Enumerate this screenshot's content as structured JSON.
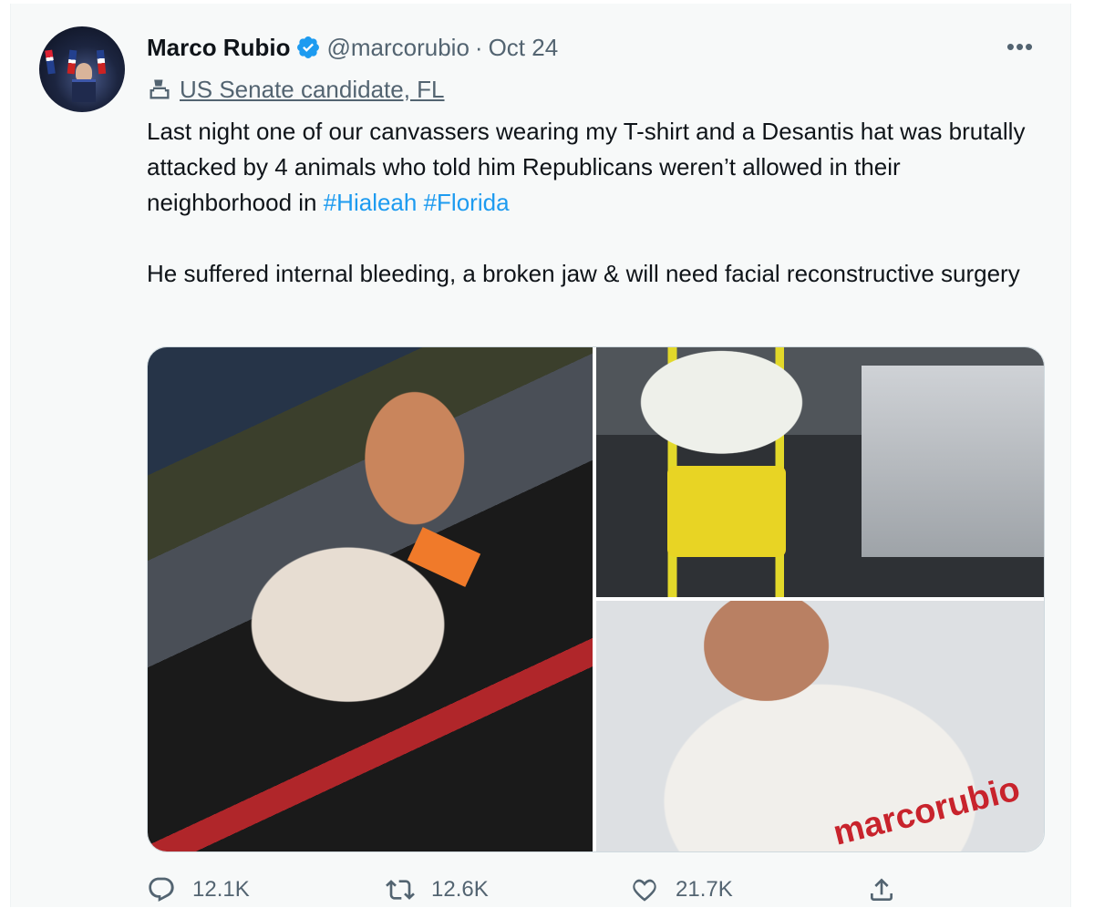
{
  "tweet": {
    "author_name": "Marco Rubio",
    "handle": "@marcorubio",
    "separator": "·",
    "date": "Oct 24",
    "more_label": "•••",
    "label": "US Senate candidate, FL",
    "text_line1": "Last night one of our canvassers wearing my T-shirt and a Desantis hat was brutally attacked by 4 animals who told him Republicans weren’t allowed in their neighborhood in ",
    "hashtags": [
      "#Hialeah",
      "#Florida"
    ],
    "text_line2": "He suffered internal bleeding, a broken jaw & will need facial reconstructive surgery",
    "photo_brand_text": "marcorubio"
  },
  "metrics": {
    "replies": "12.1K",
    "retweets": "12.6K",
    "likes": "21.7K"
  },
  "colors": {
    "accent": "#1d9bf0",
    "secondary_text": "#536471",
    "brand_red": "#c8232c"
  },
  "icons": [
    "verified-badge-icon",
    "ballot-box-icon",
    "more-options-icon",
    "reply-icon",
    "retweet-icon",
    "like-icon",
    "share-icon"
  ]
}
